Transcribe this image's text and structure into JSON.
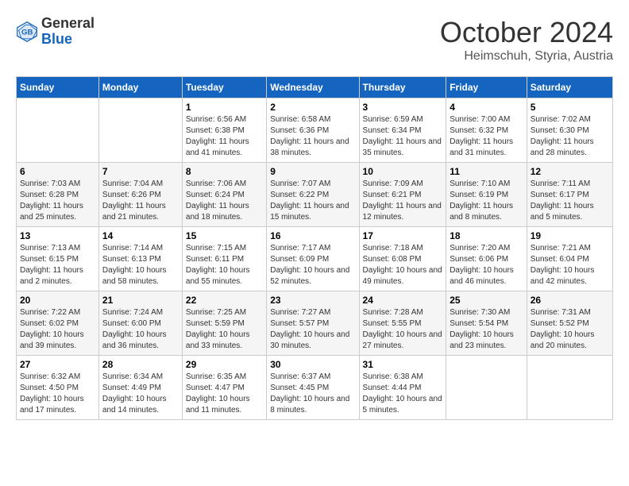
{
  "logo": {
    "general": "General",
    "blue": "Blue"
  },
  "title": "October 2024",
  "location": "Heimschuh, Styria, Austria",
  "headers": [
    "Sunday",
    "Monday",
    "Tuesday",
    "Wednesday",
    "Thursday",
    "Friday",
    "Saturday"
  ],
  "weeks": [
    [
      {
        "day": "",
        "info": ""
      },
      {
        "day": "",
        "info": ""
      },
      {
        "day": "1",
        "info": "Sunrise: 6:56 AM\nSunset: 6:38 PM\nDaylight: 11 hours and 41 minutes."
      },
      {
        "day": "2",
        "info": "Sunrise: 6:58 AM\nSunset: 6:36 PM\nDaylight: 11 hours and 38 minutes."
      },
      {
        "day": "3",
        "info": "Sunrise: 6:59 AM\nSunset: 6:34 PM\nDaylight: 11 hours and 35 minutes."
      },
      {
        "day": "4",
        "info": "Sunrise: 7:00 AM\nSunset: 6:32 PM\nDaylight: 11 hours and 31 minutes."
      },
      {
        "day": "5",
        "info": "Sunrise: 7:02 AM\nSunset: 6:30 PM\nDaylight: 11 hours and 28 minutes."
      }
    ],
    [
      {
        "day": "6",
        "info": "Sunrise: 7:03 AM\nSunset: 6:28 PM\nDaylight: 11 hours and 25 minutes."
      },
      {
        "day": "7",
        "info": "Sunrise: 7:04 AM\nSunset: 6:26 PM\nDaylight: 11 hours and 21 minutes."
      },
      {
        "day": "8",
        "info": "Sunrise: 7:06 AM\nSunset: 6:24 PM\nDaylight: 11 hours and 18 minutes."
      },
      {
        "day": "9",
        "info": "Sunrise: 7:07 AM\nSunset: 6:22 PM\nDaylight: 11 hours and 15 minutes."
      },
      {
        "day": "10",
        "info": "Sunrise: 7:09 AM\nSunset: 6:21 PM\nDaylight: 11 hours and 12 minutes."
      },
      {
        "day": "11",
        "info": "Sunrise: 7:10 AM\nSunset: 6:19 PM\nDaylight: 11 hours and 8 minutes."
      },
      {
        "day": "12",
        "info": "Sunrise: 7:11 AM\nSunset: 6:17 PM\nDaylight: 11 hours and 5 minutes."
      }
    ],
    [
      {
        "day": "13",
        "info": "Sunrise: 7:13 AM\nSunset: 6:15 PM\nDaylight: 11 hours and 2 minutes."
      },
      {
        "day": "14",
        "info": "Sunrise: 7:14 AM\nSunset: 6:13 PM\nDaylight: 10 hours and 58 minutes."
      },
      {
        "day": "15",
        "info": "Sunrise: 7:15 AM\nSunset: 6:11 PM\nDaylight: 10 hours and 55 minutes."
      },
      {
        "day": "16",
        "info": "Sunrise: 7:17 AM\nSunset: 6:09 PM\nDaylight: 10 hours and 52 minutes."
      },
      {
        "day": "17",
        "info": "Sunrise: 7:18 AM\nSunset: 6:08 PM\nDaylight: 10 hours and 49 minutes."
      },
      {
        "day": "18",
        "info": "Sunrise: 7:20 AM\nSunset: 6:06 PM\nDaylight: 10 hours and 46 minutes."
      },
      {
        "day": "19",
        "info": "Sunrise: 7:21 AM\nSunset: 6:04 PM\nDaylight: 10 hours and 42 minutes."
      }
    ],
    [
      {
        "day": "20",
        "info": "Sunrise: 7:22 AM\nSunset: 6:02 PM\nDaylight: 10 hours and 39 minutes."
      },
      {
        "day": "21",
        "info": "Sunrise: 7:24 AM\nSunset: 6:00 PM\nDaylight: 10 hours and 36 minutes."
      },
      {
        "day": "22",
        "info": "Sunrise: 7:25 AM\nSunset: 5:59 PM\nDaylight: 10 hours and 33 minutes."
      },
      {
        "day": "23",
        "info": "Sunrise: 7:27 AM\nSunset: 5:57 PM\nDaylight: 10 hours and 30 minutes."
      },
      {
        "day": "24",
        "info": "Sunrise: 7:28 AM\nSunset: 5:55 PM\nDaylight: 10 hours and 27 minutes."
      },
      {
        "day": "25",
        "info": "Sunrise: 7:30 AM\nSunset: 5:54 PM\nDaylight: 10 hours and 23 minutes."
      },
      {
        "day": "26",
        "info": "Sunrise: 7:31 AM\nSunset: 5:52 PM\nDaylight: 10 hours and 20 minutes."
      }
    ],
    [
      {
        "day": "27",
        "info": "Sunrise: 6:32 AM\nSunset: 4:50 PM\nDaylight: 10 hours and 17 minutes."
      },
      {
        "day": "28",
        "info": "Sunrise: 6:34 AM\nSunset: 4:49 PM\nDaylight: 10 hours and 14 minutes."
      },
      {
        "day": "29",
        "info": "Sunrise: 6:35 AM\nSunset: 4:47 PM\nDaylight: 10 hours and 11 minutes."
      },
      {
        "day": "30",
        "info": "Sunrise: 6:37 AM\nSunset: 4:45 PM\nDaylight: 10 hours and 8 minutes."
      },
      {
        "day": "31",
        "info": "Sunrise: 6:38 AM\nSunset: 4:44 PM\nDaylight: 10 hours and 5 minutes."
      },
      {
        "day": "",
        "info": ""
      },
      {
        "day": "",
        "info": ""
      }
    ]
  ]
}
